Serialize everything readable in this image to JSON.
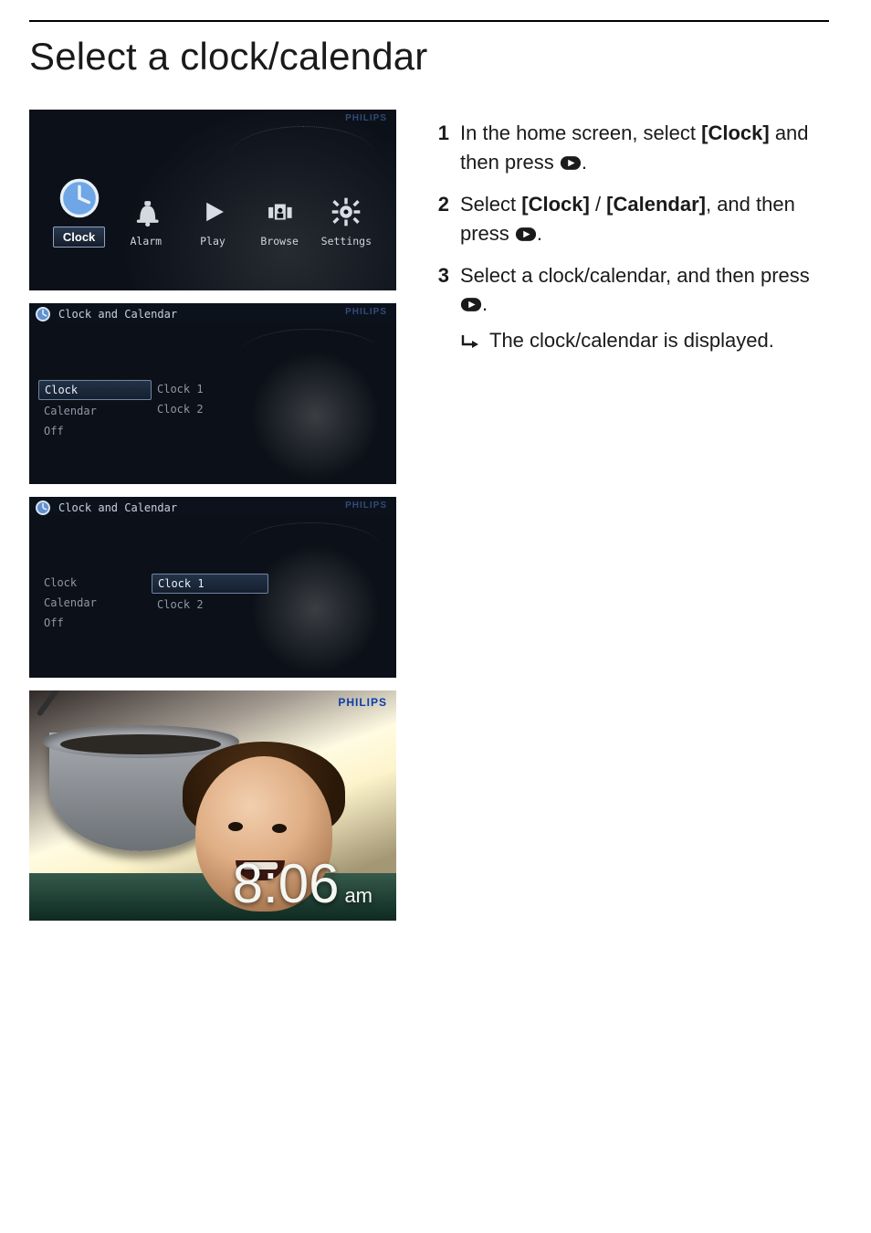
{
  "title": "Select a clock/calendar",
  "home_menu": {
    "items": [
      {
        "label": "Clock",
        "icon": "clock",
        "selected": true
      },
      {
        "label": "Alarm",
        "icon": "alarm",
        "selected": false
      },
      {
        "label": "Play",
        "icon": "play",
        "selected": false
      },
      {
        "label": "Browse",
        "icon": "browse",
        "selected": false
      },
      {
        "label": "Settings",
        "icon": "settings",
        "selected": false
      }
    ],
    "brand": "PHILIPS"
  },
  "menu_screens": [
    {
      "header": "Clock and Calendar",
      "brand": "PHILIPS",
      "left_col": [
        {
          "label": "Clock",
          "selected": true
        },
        {
          "label": "Calendar",
          "selected": false
        },
        {
          "label": "Off",
          "selected": false
        }
      ],
      "right_col": [
        {
          "label": "Clock 1",
          "selected": false
        },
        {
          "label": "Clock 2",
          "selected": false
        }
      ]
    },
    {
      "header": "Clock and Calendar",
      "brand": "PHILIPS",
      "left_col": [
        {
          "label": "Clock",
          "selected": false
        },
        {
          "label": "Calendar",
          "selected": false
        },
        {
          "label": "Off",
          "selected": false
        }
      ],
      "right_col": [
        {
          "label": "Clock 1",
          "selected": true
        },
        {
          "label": "Clock 2",
          "selected": false
        }
      ]
    }
  ],
  "photo_panel": {
    "brand": "PHILIPS",
    "time": "8:06",
    "ampm": "am"
  },
  "steps": [
    {
      "num": "1",
      "parts": [
        {
          "t": "In the home screen, select "
        },
        {
          "t": "[Clock]",
          "bold": true
        },
        {
          "t": " and then press "
        },
        {
          "icon": "play-button"
        },
        {
          "t": "."
        }
      ]
    },
    {
      "num": "2",
      "parts": [
        {
          "t": "Select "
        },
        {
          "t": "[Clock]",
          "bold": true
        },
        {
          "t": " / "
        },
        {
          "t": "[Calendar]",
          "bold": true
        },
        {
          "t": ", and then press "
        },
        {
          "icon": "play-button"
        },
        {
          "t": "."
        }
      ]
    },
    {
      "num": "3",
      "parts": [
        {
          "t": "Select a clock/calendar, and then press "
        },
        {
          "icon": "play-button"
        },
        {
          "t": "."
        }
      ],
      "result": "The clock/calendar is displayed."
    }
  ]
}
